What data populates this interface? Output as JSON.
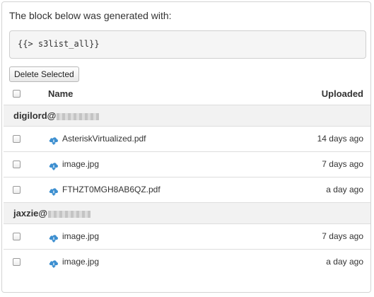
{
  "intro_text": "The block below was generated with:",
  "code_snippet": "{{> s3list_all}}",
  "delete_button_label": "Delete Selected",
  "table": {
    "headers": {
      "name": "Name",
      "uploaded": "Uploaded"
    },
    "groups": [
      {
        "owner": "digilord@",
        "files": [
          {
            "name": "AsteriskVirtualized.pdf",
            "uploaded": "14 days ago"
          },
          {
            "name": "image.jpg",
            "uploaded": "7 days ago"
          },
          {
            "name": "FTHZT0MGH8AB6QZ.pdf",
            "uploaded": "a day ago"
          }
        ]
      },
      {
        "owner": "jaxzie@",
        "files": [
          {
            "name": "image.jpg",
            "uploaded": "7 days ago"
          },
          {
            "name": "image.jpg",
            "uploaded": "a day ago"
          }
        ]
      }
    ]
  },
  "colors": {
    "icon_blue": "#3d8fd0",
    "group_bg": "#f2f2f2"
  },
  "icons": {
    "file": "cloud-download-icon"
  }
}
